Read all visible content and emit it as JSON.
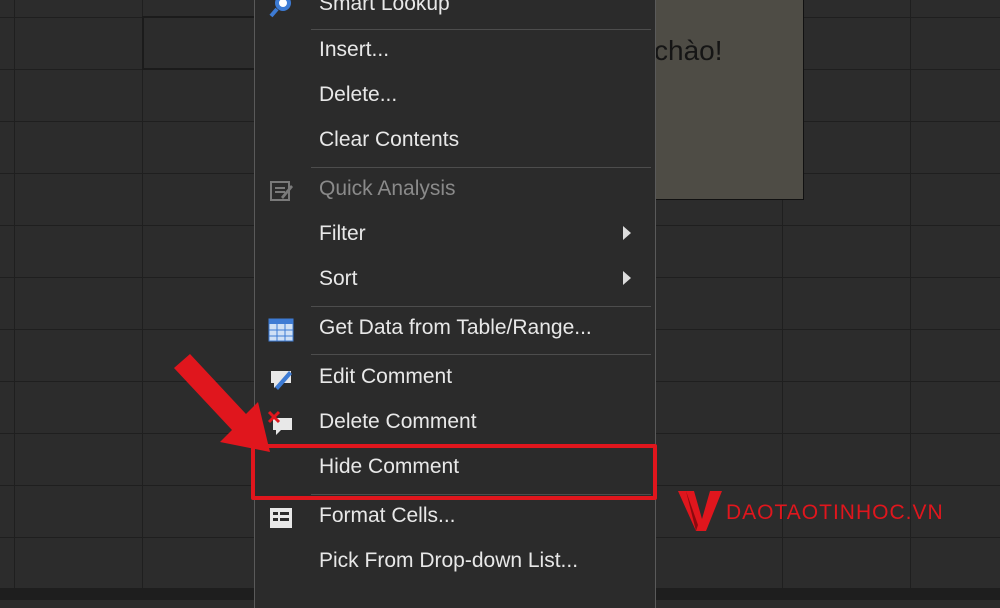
{
  "comment": {
    "text": "chào!"
  },
  "menu": {
    "items": [
      {
        "label": "Smart Lookup",
        "icon": "search-icon",
        "enabled": true
      },
      {
        "label": "Insert...",
        "icon": "",
        "enabled": true
      },
      {
        "label": "Delete...",
        "icon": "",
        "enabled": true
      },
      {
        "label": "Clear Contents",
        "icon": "",
        "enabled": true
      },
      {
        "label": "Quick Analysis",
        "icon": "quick-analysis-icon",
        "enabled": false
      },
      {
        "label": "Filter",
        "icon": "",
        "enabled": true,
        "submenu": true
      },
      {
        "label": "Sort",
        "icon": "",
        "enabled": true,
        "submenu": true
      },
      {
        "label": "Get Data from Table/Range...",
        "icon": "table-icon",
        "enabled": true
      },
      {
        "label": "Edit Comment",
        "icon": "edit-comment-icon",
        "enabled": true
      },
      {
        "label": "Delete Comment",
        "icon": "delete-comment-icon",
        "enabled": true
      },
      {
        "label": "Hide Comment",
        "icon": "",
        "enabled": true,
        "highlighted": true
      },
      {
        "label": "Format Cells...",
        "icon": "format-cells-icon",
        "enabled": true
      },
      {
        "label": "Pick From Drop-down List...",
        "icon": "",
        "enabled": true
      }
    ]
  },
  "watermark": {
    "text": "DAOTAOTINHOC.VN"
  },
  "colors": {
    "highlight": "#e0161d",
    "menu_bg": "#2b2b2b",
    "text": "#e8e8e8"
  }
}
